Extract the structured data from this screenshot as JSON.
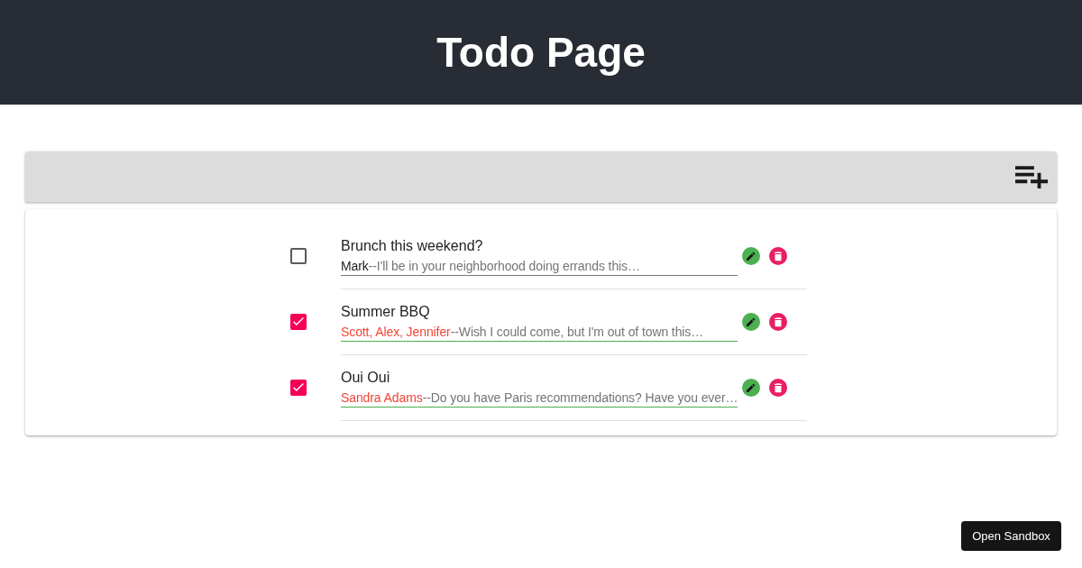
{
  "header": {
    "title": "Todo Page"
  },
  "todos": [
    {
      "title": "Brunch this weekend?",
      "sender": "Mark",
      "preview": "--I'll be in your neighborhood doing errands this…",
      "checked": false
    },
    {
      "title": "Summer BBQ",
      "sender": "Scott, Alex, Jennifer",
      "preview": "--Wish I could come, but I'm out of town this…",
      "checked": true
    },
    {
      "title": "Oui Oui",
      "sender": "Sandra Adams",
      "preview": "--Do you have Paris recommendations? Have you ever…",
      "checked": true
    }
  ],
  "sandbox_button": {
    "label": "Open Sandbox"
  }
}
